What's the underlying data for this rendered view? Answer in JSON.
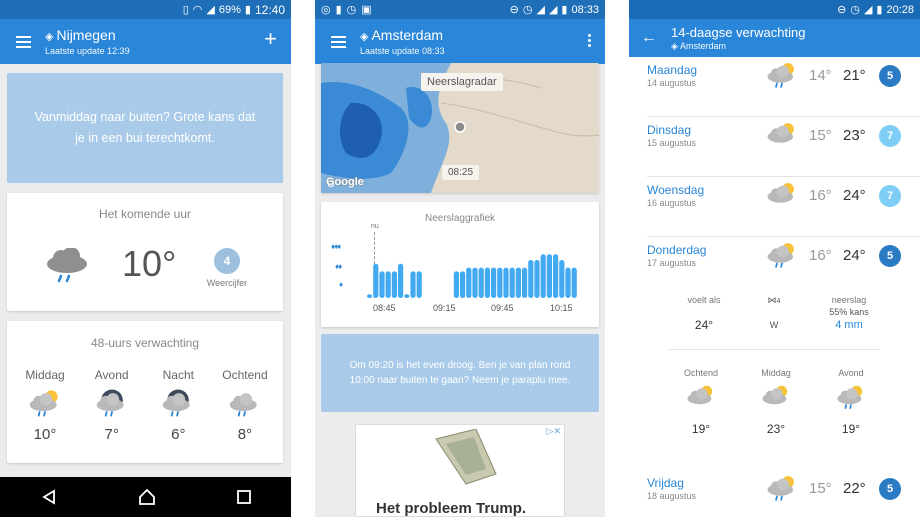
{
  "colors": {
    "appbar": "#2a86d8",
    "status": "#1e6fb8",
    "rain_card": "#a9cbe9",
    "badge_light": "#7ecdf6",
    "badge_dark": "#2a7bc4",
    "nav": "#000000"
  },
  "p1": {
    "status_time": "12:40",
    "status_battery": "69%",
    "location": "Nijmegen",
    "updated": "Laatste update 12:39",
    "alert": "Vanmiddag naar buiten? Grote kans dat je in een bui terechtkomt.",
    "hour": {
      "title": "Het komende uur",
      "temp": "10°",
      "grade": "4",
      "grade_label": "Weercijfer"
    },
    "forecast48": {
      "title": "48-uurs verwachting",
      "items": [
        {
          "label": "Middag",
          "temp": "10°",
          "icon": "sun-cloud-rain-icon"
        },
        {
          "label": "Avond",
          "temp": "7°",
          "icon": "moon-cloud-rain-icon"
        },
        {
          "label": "Nacht",
          "temp": "6°",
          "icon": "moon-cloud-rain-icon"
        },
        {
          "label": "Ochtend",
          "temp": "8°",
          "icon": "cloud-rain-icon"
        }
      ]
    }
  },
  "p2": {
    "status_time": "08:33",
    "location": "Amsterdam",
    "updated": "Laatste update 08:33",
    "map": {
      "label": "Neerslagradar",
      "time": "08:25",
      "brand": "Google"
    },
    "graph": {
      "title": "Neerslaggrafiek",
      "now_label": "nu",
      "ticks": [
        "08:45",
        "09:15",
        "09:45",
        "10:15"
      ],
      "bars": [
        0.1,
        0.9,
        0.7,
        0.7,
        0.7,
        0.9,
        0.1,
        0.7,
        0.7,
        0,
        0,
        0,
        0,
        0,
        0.7,
        0.7,
        0.8,
        0.8,
        0.8,
        0.8,
        0.8,
        0.8,
        0.8,
        0.8,
        0.8,
        0.8,
        1,
        1,
        1.15,
        1.15,
        1.15,
        1,
        0.8,
        0.8
      ]
    },
    "alert": "Om 09:20 is het even droog. Ben je van plan rond 10:00 naar buiten te gaan? Neem je paraplu mee.",
    "ad_text": "Het probleem Trump."
  },
  "p3": {
    "status_time": "20:28",
    "title": "14-daagse verwachting",
    "location": "Amsterdam",
    "days": [
      {
        "name": "Maandag",
        "date": "14 augustus",
        "min": "14°",
        "max": "21°",
        "grade": "5",
        "light": false,
        "icon": "sun-cloud-rain-icon"
      },
      {
        "name": "Dinsdag",
        "date": "15 augustus",
        "min": "15°",
        "max": "23°",
        "grade": "7",
        "light": true,
        "icon": "sun-cloud-icon"
      },
      {
        "name": "Woensdag",
        "date": "16 augustus",
        "min": "16°",
        "max": "24°",
        "grade": "7",
        "light": true,
        "icon": "sun-cloud-icon"
      },
      {
        "name": "Donderdag",
        "date": "17 augustus",
        "min": "16°",
        "max": "24°",
        "grade": "5",
        "light": false,
        "icon": "sun-cloud-rain-icon"
      }
    ],
    "details": {
      "feels_label": "voelt als",
      "feels": "24°",
      "wind_force": "4",
      "wind_dir": "W",
      "precip_label": "neerslag",
      "precip_chance": "55% kans",
      "precip_amount": "4 mm"
    },
    "parts": [
      {
        "label": "Ochtend",
        "temp": "19°"
      },
      {
        "label": "Middag",
        "temp": "23°"
      },
      {
        "label": "Avond",
        "temp": "19°"
      }
    ],
    "last": {
      "name": "Vrijdag",
      "date": "18 augustus",
      "min": "15°",
      "max": "22°",
      "grade": "5"
    }
  }
}
